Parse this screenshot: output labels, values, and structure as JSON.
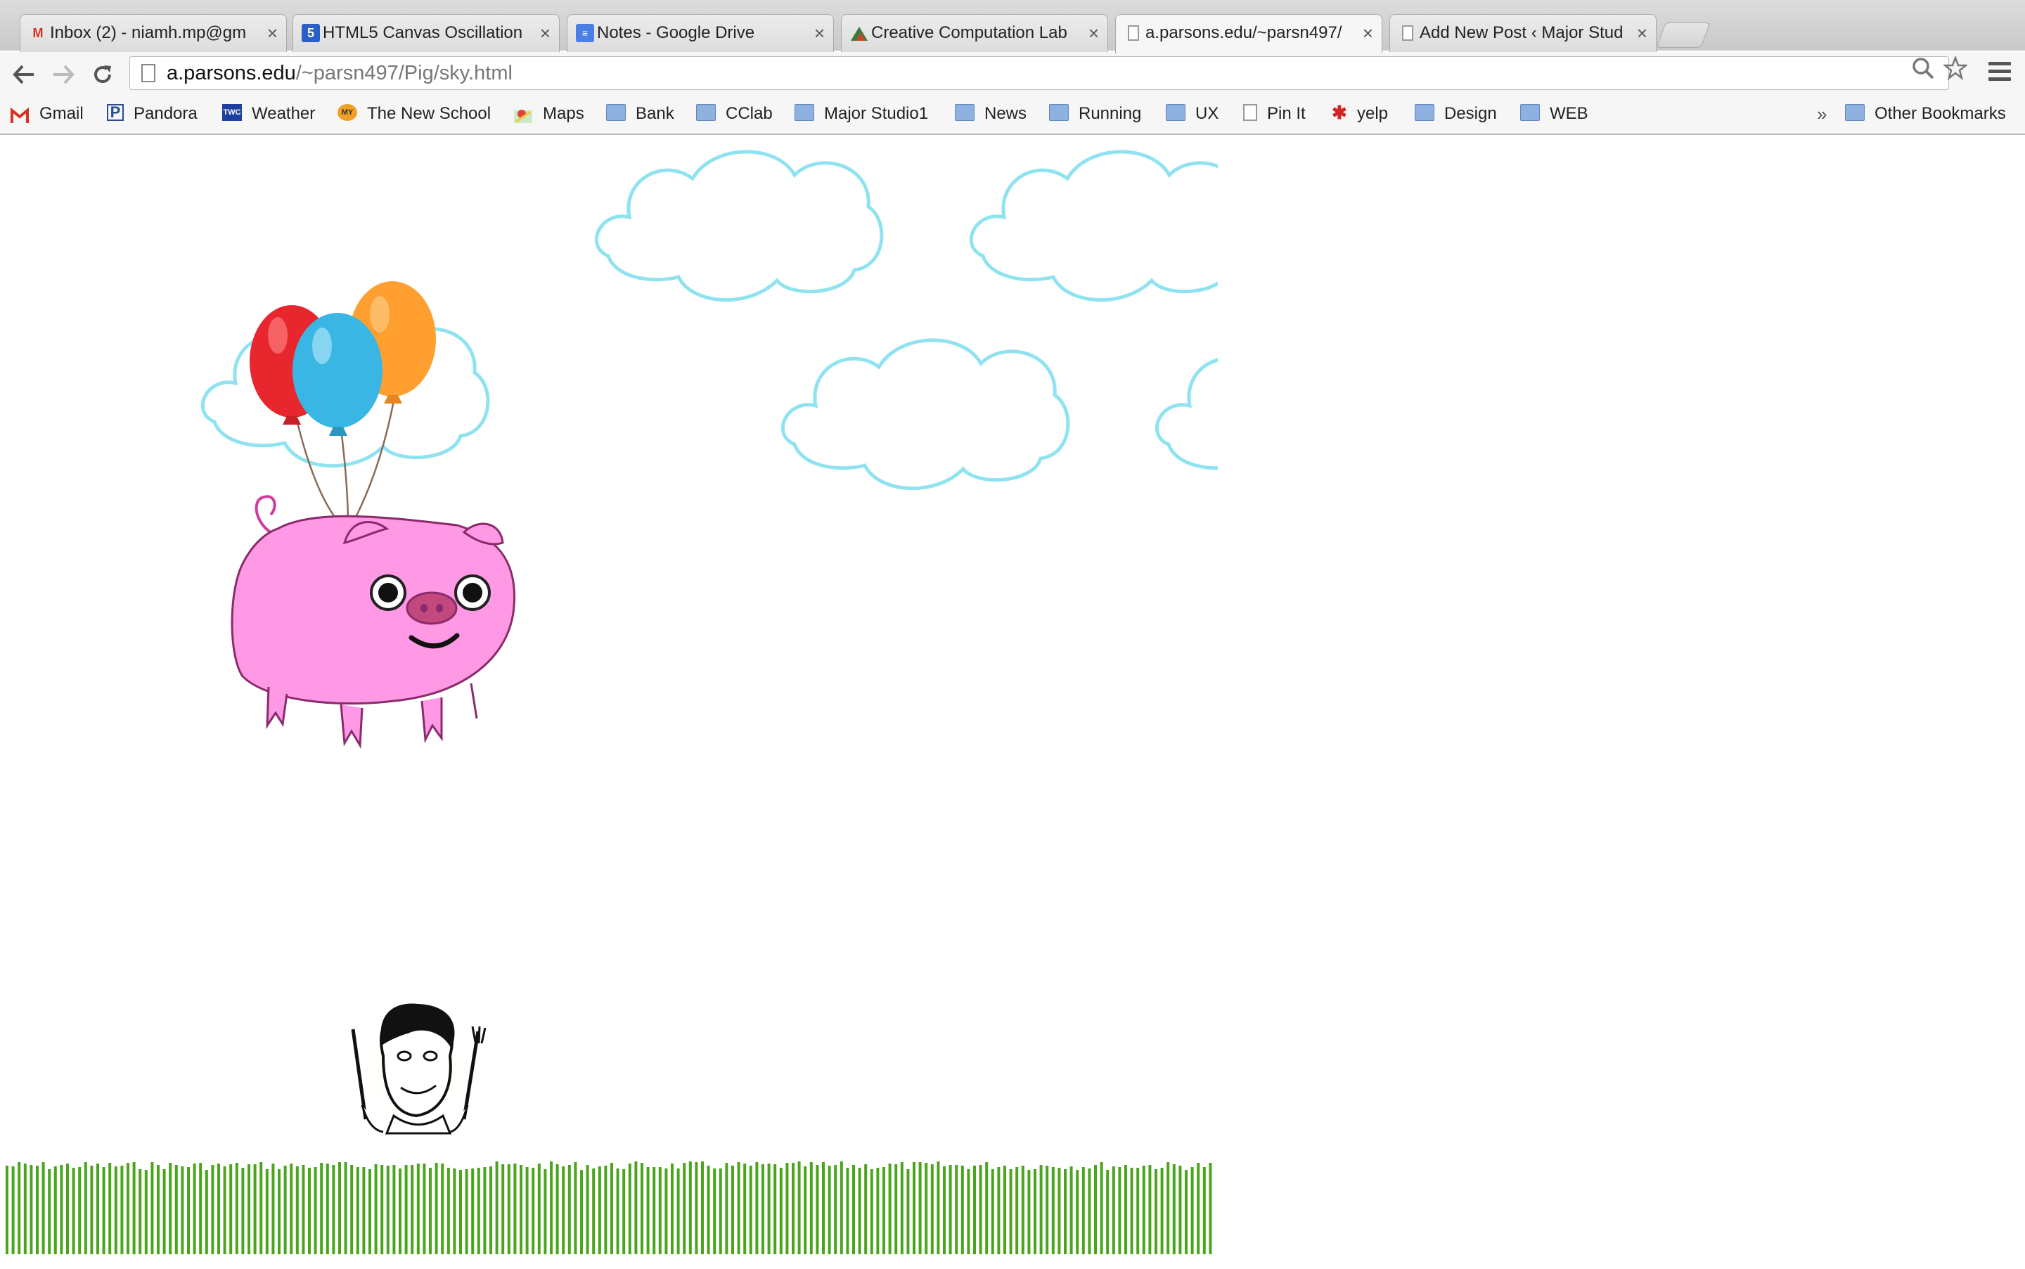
{
  "browser": {
    "tabs": [
      {
        "title": "Inbox (2) - niamh.mp@gm",
        "icon": "gmail-icon",
        "active": false
      },
      {
        "title": "HTML5 Canvas Oscillation",
        "icon": "html5-icon",
        "active": false
      },
      {
        "title": "Notes - Google Drive",
        "icon": "google-docs-icon",
        "active": false
      },
      {
        "title": "Creative Computation Lab",
        "icon": "cclab-icon",
        "active": false
      },
      {
        "title": "a.parsons.edu/~parsn497/",
        "icon": "page-icon",
        "active": true
      },
      {
        "title": "Add New Post ‹ Major Stud",
        "icon": "page-icon",
        "active": false
      }
    ],
    "url": {
      "host": "a.parsons.edu",
      "path": "/~parsn497/Pig/sky.html"
    },
    "bookmarks": [
      {
        "label": "Gmail",
        "icon": "gmail-icon"
      },
      {
        "label": "Pandora",
        "icon": "pandora-icon"
      },
      {
        "label": "Weather",
        "icon": "twc-icon"
      },
      {
        "label": "The New School",
        "icon": "newschool-icon"
      },
      {
        "label": "Maps",
        "icon": "maps-icon"
      },
      {
        "label": "Bank",
        "icon": "folder-icon"
      },
      {
        "label": "CClab",
        "icon": "folder-icon"
      },
      {
        "label": "Major Studio1",
        "icon": "folder-icon"
      },
      {
        "label": "News",
        "icon": "folder-icon"
      },
      {
        "label": "Running",
        "icon": "folder-icon"
      },
      {
        "label": "UX",
        "icon": "folder-icon"
      },
      {
        "label": "Pin It",
        "icon": "page-icon"
      },
      {
        "label": "yelp",
        "icon": "yelp-icon"
      },
      {
        "label": "Design",
        "icon": "folder-icon"
      },
      {
        "label": "WEB",
        "icon": "folder-icon"
      }
    ],
    "overflow": "»",
    "other_bookmarks": "Other Bookmarks",
    "close_glyph": "×"
  },
  "scene": {
    "sky_outline_color": "#8fe3f1",
    "pig_color": "#ff99e6",
    "pig_outline_color": "#8b2a6b",
    "balloon_colors": [
      "#e8262e",
      "#39b6e4",
      "#ff9f30"
    ],
    "grass_color": "#4aa51c"
  }
}
